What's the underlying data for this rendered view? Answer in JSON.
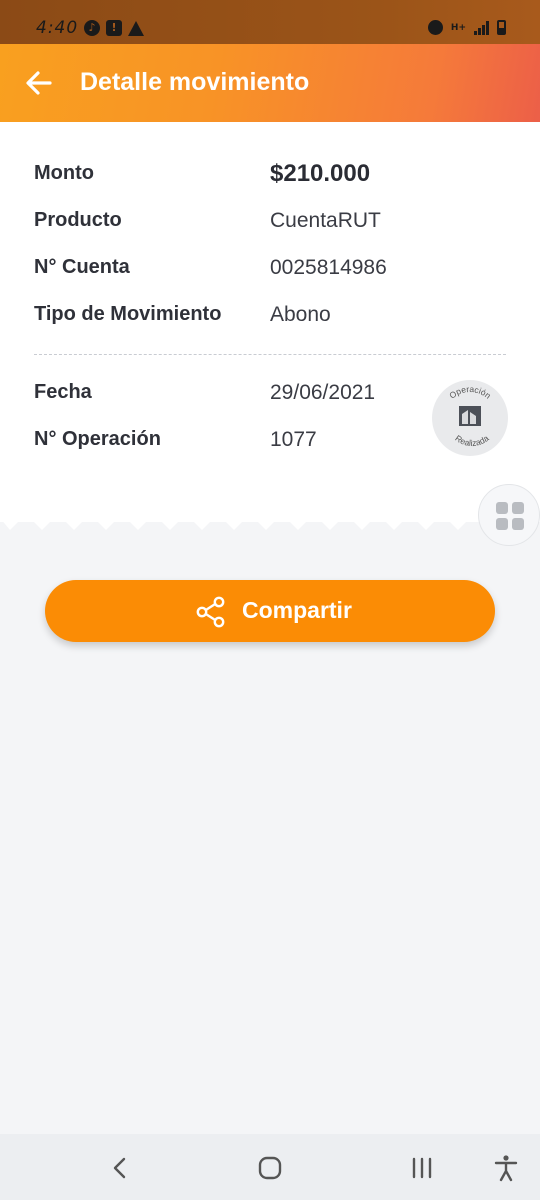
{
  "status_bar": {
    "time": "4:40",
    "network_label": "H+"
  },
  "header": {
    "title": "Detalle movimiento"
  },
  "details": {
    "monto_label": "Monto",
    "monto_value": "$210.000",
    "producto_label": "Producto",
    "producto_value": "CuentaRUT",
    "cuenta_label": "N° Cuenta",
    "cuenta_value": "0025814986",
    "tipo_label": "Tipo de Movimiento",
    "tipo_value": "Abono",
    "fecha_label": "Fecha",
    "fecha_value": "29/06/2021",
    "operacion_label": "N° Operación",
    "operacion_value": "1077"
  },
  "stamp": {
    "top_text": "Operación",
    "bottom_text": "Realizada"
  },
  "actions": {
    "share_label": "Compartir"
  },
  "colors": {
    "accent": "#fb8c05",
    "header_start": "#f9a01f",
    "header_end": "#ec5f48"
  },
  "icons": {
    "back": "arrow-left-icon",
    "share": "share-icon",
    "grid": "grid-icon"
  }
}
